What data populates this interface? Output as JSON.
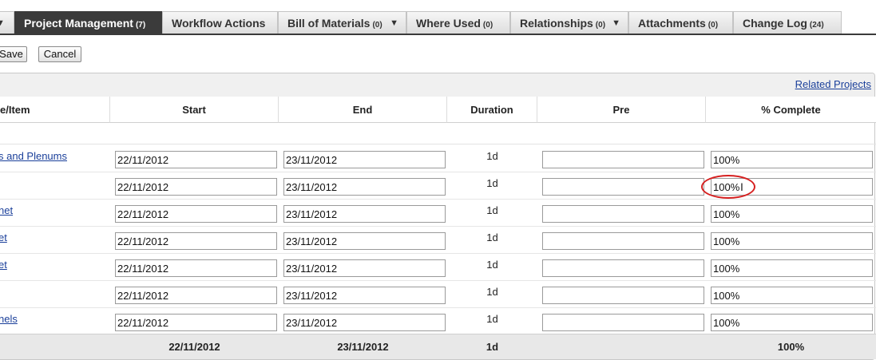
{
  "tabs": [
    {
      "label": "Project Management",
      "count": "(7)",
      "active": true
    },
    {
      "label": "Workflow Actions",
      "count": ""
    },
    {
      "label": "Bill of Materials",
      "count": "(0)",
      "dropdown": true
    },
    {
      "label": "Where Used",
      "count": "(0)"
    },
    {
      "label": "Relationships",
      "count": "(0)",
      "dropdown": true
    },
    {
      "label": "Attachments",
      "count": "(0)"
    },
    {
      "label": "Change Log",
      "count": "(24)"
    }
  ],
  "icons": {
    "caret": "chevron-down-icon",
    "text_cursor": "text-cursor-icon"
  },
  "toolbar": {
    "save_label": "Save",
    "cancel_label": "Cancel"
  },
  "panel": {
    "related_projects": "Related Projects"
  },
  "columns": {
    "item": "e/Item",
    "start": "Start",
    "end": "End",
    "duration": "Duration",
    "pre": "Pre",
    "complete": "% Complete"
  },
  "rows": [
    {
      "item": "s and Plenums",
      "start": "22/11/2012",
      "end": "23/11/2012",
      "duration": "1d",
      "pre": "",
      "complete": "100%"
    },
    {
      "item": "",
      "start": "22/11/2012",
      "end": "23/11/2012",
      "duration": "1d",
      "pre": "",
      "complete": "100%"
    },
    {
      "item": "net",
      "start": "22/11/2012",
      "end": "23/11/2012",
      "duration": "1d",
      "pre": "",
      "complete": "100%"
    },
    {
      "item": "et",
      "start": "22/11/2012",
      "end": "23/11/2012",
      "duration": "1d",
      "pre": "",
      "complete": "100%"
    },
    {
      "item": "et",
      "start": "22/11/2012",
      "end": "23/11/2012",
      "duration": "1d",
      "pre": "",
      "complete": "100%"
    },
    {
      "item": "",
      "start": "22/11/2012",
      "end": "23/11/2012",
      "duration": "1d",
      "pre": "",
      "complete": "100%"
    },
    {
      "item": "nels",
      "start": "22/11/2012",
      "end": "23/11/2012",
      "duration": "1d",
      "pre": "",
      "complete": "100%"
    }
  ],
  "totals": {
    "start": "22/11/2012",
    "end": "23/11/2012",
    "duration": "1d",
    "complete": "100%"
  },
  "colors": {
    "active_tab": "#3b3b3b",
    "link": "#1a3f9a",
    "highlight": "#d62020"
  }
}
